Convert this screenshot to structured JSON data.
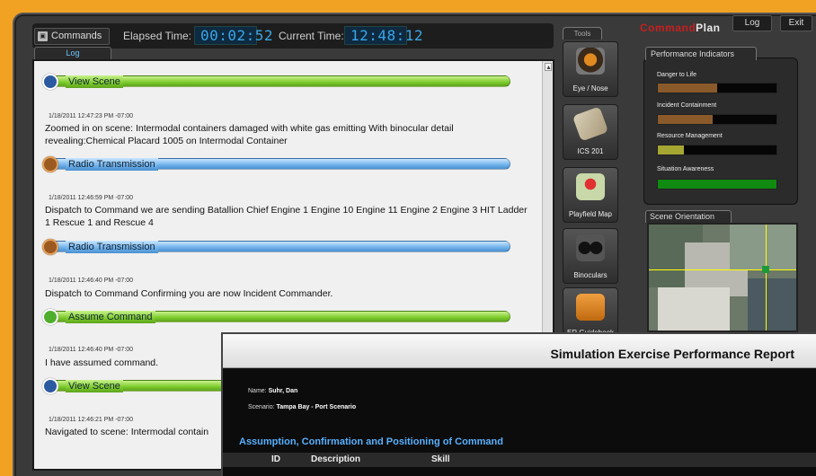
{
  "header": {
    "commands_label": "Commands",
    "elapsed_label": "Elapsed Time:",
    "elapsed_value": "00:02:52",
    "current_label": "Current Time:",
    "current_value": "12:48:12",
    "log_tab": "Log"
  },
  "brand": {
    "command": "Command",
    "plan": "Plan"
  },
  "top_buttons": {
    "log": "Log",
    "exit": "Exit"
  },
  "log": {
    "entries": [
      {
        "bar": "View Scene",
        "timestamp": "",
        "message": ""
      },
      {
        "bar": "",
        "timestamp": "1/18/2011 12:47:23 PM -07:00",
        "message": "Zoomed in on scene: Intermodal containers damaged with white gas emitting With binocular detail revealing:Chemical Placard 1005 on Intermodal Container"
      },
      {
        "bar": "Radio Transmission",
        "timestamp": "",
        "message": ""
      },
      {
        "bar": "",
        "timestamp": "1/18/2011 12:46:59 PM -07:00",
        "message": "Dispatch to Command we are sending Batallion Chief Engine 1 Engine 10 Engine 11 Engine 2 Engine 3 HIT Ladder 1 Rescue 1 and Rescue 4"
      },
      {
        "bar": "Radio Transmission",
        "timestamp": "",
        "message": ""
      },
      {
        "bar": "",
        "timestamp": "1/18/2011 12:46:40 PM -07:00",
        "message": "Dispatch to Command Confirming you are now Incident Commander."
      },
      {
        "bar": "Assume Command",
        "timestamp": "",
        "message": ""
      },
      {
        "bar": "",
        "timestamp": "1/18/2011 12:46:40 PM -07:00",
        "message": "I have assumed command."
      },
      {
        "bar": "View Scene",
        "timestamp": "",
        "message": ""
      },
      {
        "bar": "",
        "timestamp": "1/18/2011 12:46:21 PM -07:00",
        "message": "Navigated to scene: Intermodal contain"
      }
    ]
  },
  "tools": {
    "header": "Tools",
    "items": [
      {
        "label": "Eye / Nose",
        "icon": "gas-mask-icon"
      },
      {
        "label": "ICS 201",
        "icon": "clipboard-icon"
      },
      {
        "label": "Playfield Map",
        "icon": "map-pin-icon"
      },
      {
        "label": "Binoculars",
        "icon": "binoculars-icon"
      },
      {
        "label": "ER Guidebook",
        "icon": "book-icon"
      }
    ]
  },
  "performance": {
    "title": "Performance Indicators",
    "indicators": [
      {
        "label": "Danger to Life",
        "level": 0.5,
        "color": "#8a5a2a"
      },
      {
        "label": "Incident Containment",
        "level": 0.46,
        "color": "#8a5a2a"
      },
      {
        "label": "Resource Management",
        "level": 0.22,
        "color": "#a6a632"
      },
      {
        "label": "Situation Awareness",
        "level": 1.0,
        "color": "#108a10"
      }
    ]
  },
  "scene": {
    "title": "Scene Orientation"
  },
  "report": {
    "title": "Simulation Exercise Performance Report",
    "name_label": "Name:",
    "name_value": "Suhr, Dan",
    "scenario_label": "Scenario:",
    "scenario_value": "Tampa Bay - Port Scenario",
    "section": "Assumption, Confirmation and Positioning of Command",
    "col_id": "ID",
    "col_desc": "Description",
    "col_skill": "Skill"
  }
}
